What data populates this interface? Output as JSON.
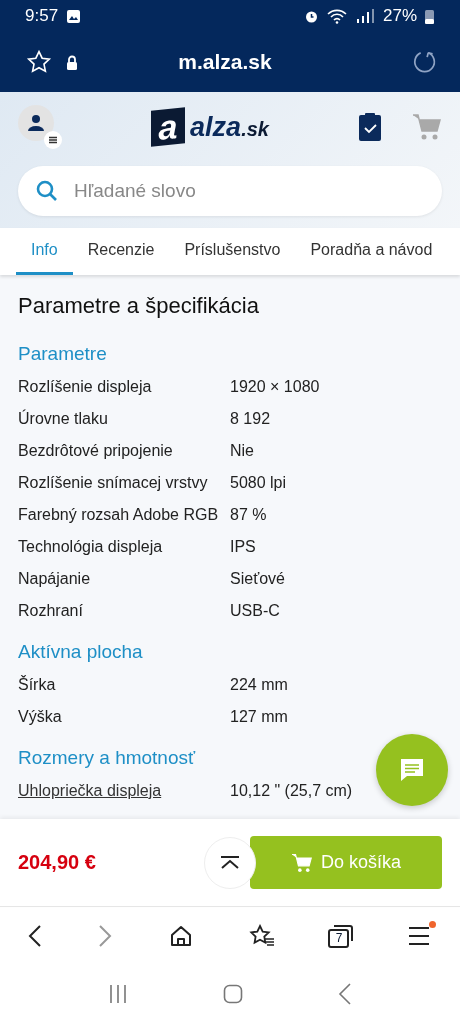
{
  "status_bar": {
    "time": "9:57",
    "battery": "27%"
  },
  "browser": {
    "url": "m.alza.sk",
    "tab_count": "7",
    "menu_notification": true
  },
  "header": {
    "logo": {
      "mark": "a",
      "name": "alza",
      "domain": ".sk"
    },
    "search": {
      "placeholder": "Hľadané slovo"
    }
  },
  "tabs": [
    {
      "label": "Info",
      "selected": true
    },
    {
      "label": "Recenzie",
      "selected": false
    },
    {
      "label": "Príslušenstvo",
      "selected": false
    },
    {
      "label": "Poradňa a návod",
      "selected": false
    }
  ],
  "page_title": "Parametre a špecifikácia",
  "sections": [
    {
      "title": "Parametre",
      "rows": [
        {
          "label": "Rozlíšenie displeja",
          "value": "1920 × 1080",
          "linked": false
        },
        {
          "label": "Úrovne tlaku",
          "value": "8 192",
          "linked": false
        },
        {
          "label": "Bezdrôtové pripojenie",
          "value": "Nie",
          "linked": false
        },
        {
          "label": "Rozlíšenie snímacej vrstvy",
          "value": "5080 lpi",
          "linked": false
        },
        {
          "label": "Farebný rozsah Adobe RGB",
          "value": "87 %",
          "linked": false
        },
        {
          "label": "Technológia displeja",
          "value": "IPS",
          "linked": false
        },
        {
          "label": "Napájanie",
          "value": "Sieťové",
          "linked": false
        },
        {
          "label": "Rozhraní",
          "value": "USB-C",
          "linked": false
        }
      ]
    },
    {
      "title": "Aktívna plocha",
      "rows": [
        {
          "label": "Šírka",
          "value": "224 mm",
          "linked": false
        },
        {
          "label": "Výška",
          "value": "127 mm",
          "linked": false
        }
      ]
    },
    {
      "title": "Rozmery a hmotnosť",
      "rows": [
        {
          "label": "Uhlopriečka displeja",
          "value": "10,12 \" (25,7 cm)",
          "linked": true
        }
      ]
    }
  ],
  "purchase": {
    "price": "204,90 €",
    "button": "Do košíka"
  }
}
